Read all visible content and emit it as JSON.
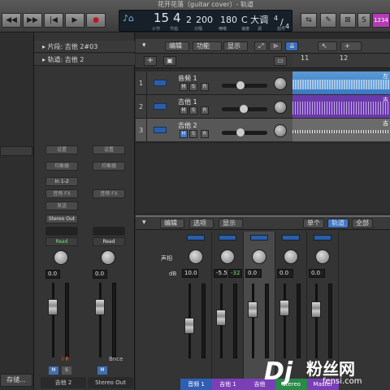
{
  "window": {
    "title": "花开花落（guitar cover）- 轨道"
  },
  "transport": {
    "rewind": "◀◀",
    "forward": "▶▶",
    "to_start": "|◀",
    "play": "▶",
    "record": "●",
    "bar": "15",
    "beat": "4",
    "tempo": "2",
    "division": "200",
    "tick": "180",
    "key": "C 大调",
    "sig_top": "4",
    "sig_bottom": "4",
    "lcd_sub": [
      "小节",
      "节拍",
      "分隔",
      "嘀嗒",
      "速度",
      "调",
      "拍号"
    ],
    "counter": "1234"
  },
  "inspector": {
    "region": "片段: 吉他 2#03",
    "track": "轨道: 吉他 2",
    "save": "存储..."
  },
  "channels": [
    {
      "setting": "设置",
      "eq": "均衡器",
      "input": "In 1-2",
      "fx": "音频 FX",
      "send": "发送",
      "output": "Stereo Out",
      "automation": "Read",
      "pan": "0.0",
      "name": "吉他 2",
      "ir": "I R"
    },
    {
      "setting": "设置",
      "eq": "均衡器",
      "input": "",
      "fx": "音频 FX",
      "send": "",
      "output": "",
      "automation": "Read",
      "pan": "0.0",
      "name": "Stereo Out",
      "ir": "Bnce"
    }
  ],
  "tracks_toolbar": {
    "edit": "编辑",
    "function": "功能",
    "view": "显示"
  },
  "ruler": {
    "m11": "11",
    "m12": "12"
  },
  "tracks": [
    {
      "num": "1",
      "name": "音频 1",
      "m": "M",
      "s": "S",
      "r": "R",
      "region_label": "左"
    },
    {
      "num": "2",
      "name": "吉他 1",
      "m": "M",
      "s": "S",
      "r": "R",
      "region_label": "吉"
    },
    {
      "num": "3",
      "name": "吉他 2",
      "m": "M",
      "s": "S",
      "r": "R",
      "region_label": "吉"
    }
  ],
  "mixer": {
    "edit": "编辑",
    "options": "选项",
    "view": "显示",
    "single": "单个",
    "tracks": "轨道",
    "all": "全部",
    "pan_label": "声相",
    "db_label": "dB",
    "strips": [
      {
        "pan": "10.0",
        "peak": "",
        "name": "音频 1",
        "color": "#2e5fb5"
      },
      {
        "pan": "-5.5",
        "peak": "-32",
        "name": "吉他 1",
        "color": "#7a3fb6"
      },
      {
        "pan": "0.0",
        "peak": "",
        "name": "吉他",
        "color": "#7a3fb6"
      },
      {
        "pan": "0.0",
        "peak": "",
        "name": "Stereo",
        "color": "#2a8a4a"
      },
      {
        "pan": "0.0",
        "peak": "",
        "name": "Master",
        "color": "#7a3fb6"
      }
    ]
  },
  "watermark": {
    "brand": "粉丝网",
    "url": "fensi.com"
  }
}
